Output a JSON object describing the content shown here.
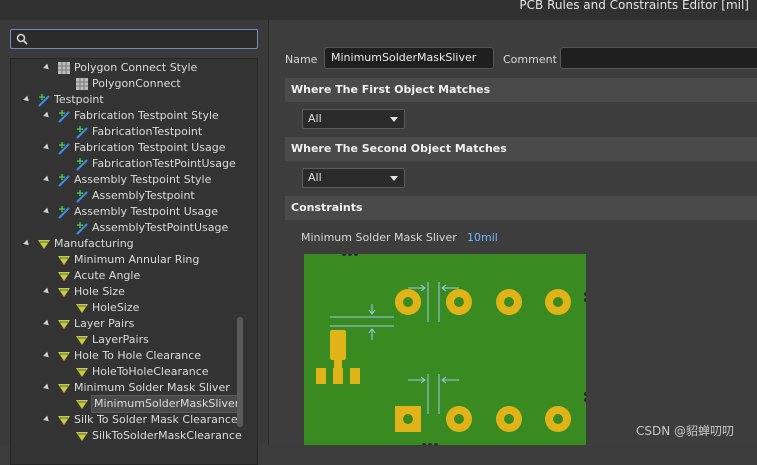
{
  "window": {
    "title": "PCB Rules and Constraints Editor [mil]"
  },
  "search": {
    "placeholder": ""
  },
  "tree": [
    {
      "label": "Polygon Connect Style",
      "level": 2,
      "expanded": true,
      "icon": "polygon-icon"
    },
    {
      "label": "PolygonConnect",
      "level": 3,
      "expanded": false,
      "icon": "polygon-icon"
    },
    {
      "label": "Testpoint",
      "level": 1,
      "expanded": true,
      "icon": "testpoint-icon"
    },
    {
      "label": "Fabrication Testpoint Style",
      "level": 2,
      "expanded": true,
      "icon": "testpoint-icon"
    },
    {
      "label": "FabricationTestpoint",
      "level": 3,
      "expanded": false,
      "icon": "testpoint-icon"
    },
    {
      "label": "Fabrication Testpoint Usage",
      "level": 2,
      "expanded": true,
      "icon": "testpoint-icon"
    },
    {
      "label": "FabricationTestPointUsage",
      "level": 3,
      "expanded": false,
      "icon": "testpoint-icon"
    },
    {
      "label": "Assembly Testpoint Style",
      "level": 2,
      "expanded": true,
      "icon": "testpoint-icon"
    },
    {
      "label": "AssemblyTestpoint",
      "level": 3,
      "expanded": false,
      "icon": "testpoint-icon"
    },
    {
      "label": "Assembly Testpoint Usage",
      "level": 2,
      "expanded": true,
      "icon": "testpoint-icon"
    },
    {
      "label": "AssemblyTestPointUsage",
      "level": 3,
      "expanded": false,
      "icon": "testpoint-icon"
    },
    {
      "label": "Manufacturing",
      "level": 1,
      "expanded": true,
      "icon": "manufacturing-icon"
    },
    {
      "label": "Minimum Annular Ring",
      "level": 2,
      "expanded": false,
      "icon": "manufacturing-icon"
    },
    {
      "label": "Acute Angle",
      "level": 2,
      "expanded": false,
      "icon": "manufacturing-icon"
    },
    {
      "label": "Hole Size",
      "level": 2,
      "expanded": true,
      "icon": "manufacturing-icon"
    },
    {
      "label": "HoleSize",
      "level": 3,
      "expanded": false,
      "icon": "manufacturing-icon"
    },
    {
      "label": "Layer Pairs",
      "level": 2,
      "expanded": true,
      "icon": "manufacturing-icon"
    },
    {
      "label": "LayerPairs",
      "level": 3,
      "expanded": false,
      "icon": "manufacturing-icon"
    },
    {
      "label": "Hole To Hole Clearance",
      "level": 2,
      "expanded": true,
      "icon": "manufacturing-icon"
    },
    {
      "label": "HoleToHoleClearance",
      "level": 3,
      "expanded": false,
      "icon": "manufacturing-icon"
    },
    {
      "label": "Minimum Solder Mask Sliver",
      "level": 2,
      "expanded": true,
      "icon": "manufacturing-icon"
    },
    {
      "label": "MinimumSolderMaskSliver",
      "level": 3,
      "expanded": false,
      "icon": "manufacturing-icon",
      "selected": true
    },
    {
      "label": "Silk To Solder Mask Clearance",
      "level": 2,
      "expanded": true,
      "icon": "manufacturing-icon"
    },
    {
      "label": "SilkToSolderMaskClearance",
      "level": 3,
      "expanded": false,
      "icon": "manufacturing-icon"
    }
  ],
  "rule": {
    "name_label": "Name",
    "name_value": "MinimumSolderMaskSliver",
    "comment_label": "Comment",
    "comment_value": ""
  },
  "sections": {
    "first_match": "Where The First Object Matches",
    "second_match": "Where The Second Object Matches",
    "constraints": "Constraints"
  },
  "first_match_select": "All",
  "second_match_select": "All",
  "constraint": {
    "label": "Minimum Solder Mask Sliver",
    "value": "10mil"
  },
  "watermark": "CSDN @貂蝉叨叨",
  "colors": {
    "pcb_green": "#3a8a22",
    "pad_yellow": "#e0b318",
    "link_blue": "#6fb5ff"
  }
}
